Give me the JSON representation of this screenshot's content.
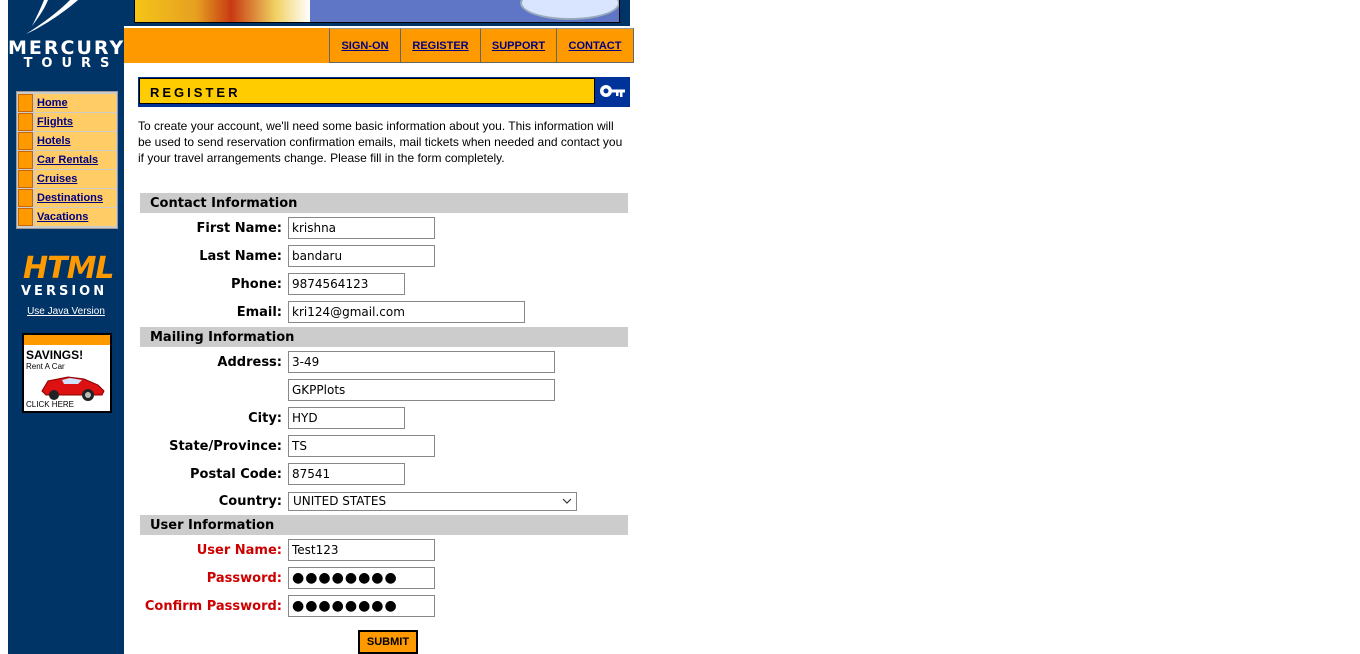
{
  "brand": {
    "line1": "MERCURY",
    "line2": "TOURS"
  },
  "side_nav": [
    {
      "label": "Home"
    },
    {
      "label": "Flights"
    },
    {
      "label": "Hotels"
    },
    {
      "label": "Car Rentals"
    },
    {
      "label": "Cruises"
    },
    {
      "label": "Destinations"
    },
    {
      "label": "Vacations"
    }
  ],
  "html_version": {
    "big": "HTML",
    "small": "VERSION",
    "java_link": "Use Java Version"
  },
  "ad": {
    "headline": "SAVINGS!",
    "subline": "Rent A Car",
    "cta": "CLICK HERE"
  },
  "top_nav": [
    {
      "label": "SIGN-ON"
    },
    {
      "label": "REGISTER"
    },
    {
      "label": "SUPPORT"
    },
    {
      "label": "CONTACT"
    }
  ],
  "page_title": "REGISTER",
  "intro": "To create your account, we'll need some basic information about you. This information will be used to send reservation confirmation emails, mail tickets when needed and contact you if your travel arrangements change. Please fill in the form completely.",
  "sections": {
    "contact": "Contact Information",
    "mailing": "Mailing Information",
    "user": "User Information"
  },
  "fields": {
    "first_name": {
      "label": "First Name:",
      "value": "krishna"
    },
    "last_name": {
      "label": "Last Name:",
      "value": "bandaru"
    },
    "phone": {
      "label": "Phone:",
      "value": "9874564123"
    },
    "email": {
      "label": "Email:",
      "value": "kri124@gmail.com"
    },
    "address1": {
      "label": "Address:",
      "value": "3-49"
    },
    "address2": {
      "value": "GKPPlots"
    },
    "city": {
      "label": "City:",
      "value": "HYD"
    },
    "state": {
      "label": "State/Province:",
      "value": "TS"
    },
    "postal": {
      "label": "Postal Code:",
      "value": "87541"
    },
    "country": {
      "label": "Country:",
      "value": "UNITED STATES"
    },
    "username": {
      "label": "User Name:",
      "value": "Test123"
    },
    "password": {
      "label": "Password:",
      "value": "●●●●●●●●"
    },
    "confirm_password": {
      "label": "Confirm Password:",
      "value": "●●●●●●●●"
    }
  },
  "submit_label": "SUBMIT",
  "colors": {
    "sidebar": "#003366",
    "orange": "#ff9900",
    "yellow": "#ffcc00",
    "required": "#cc0000"
  }
}
